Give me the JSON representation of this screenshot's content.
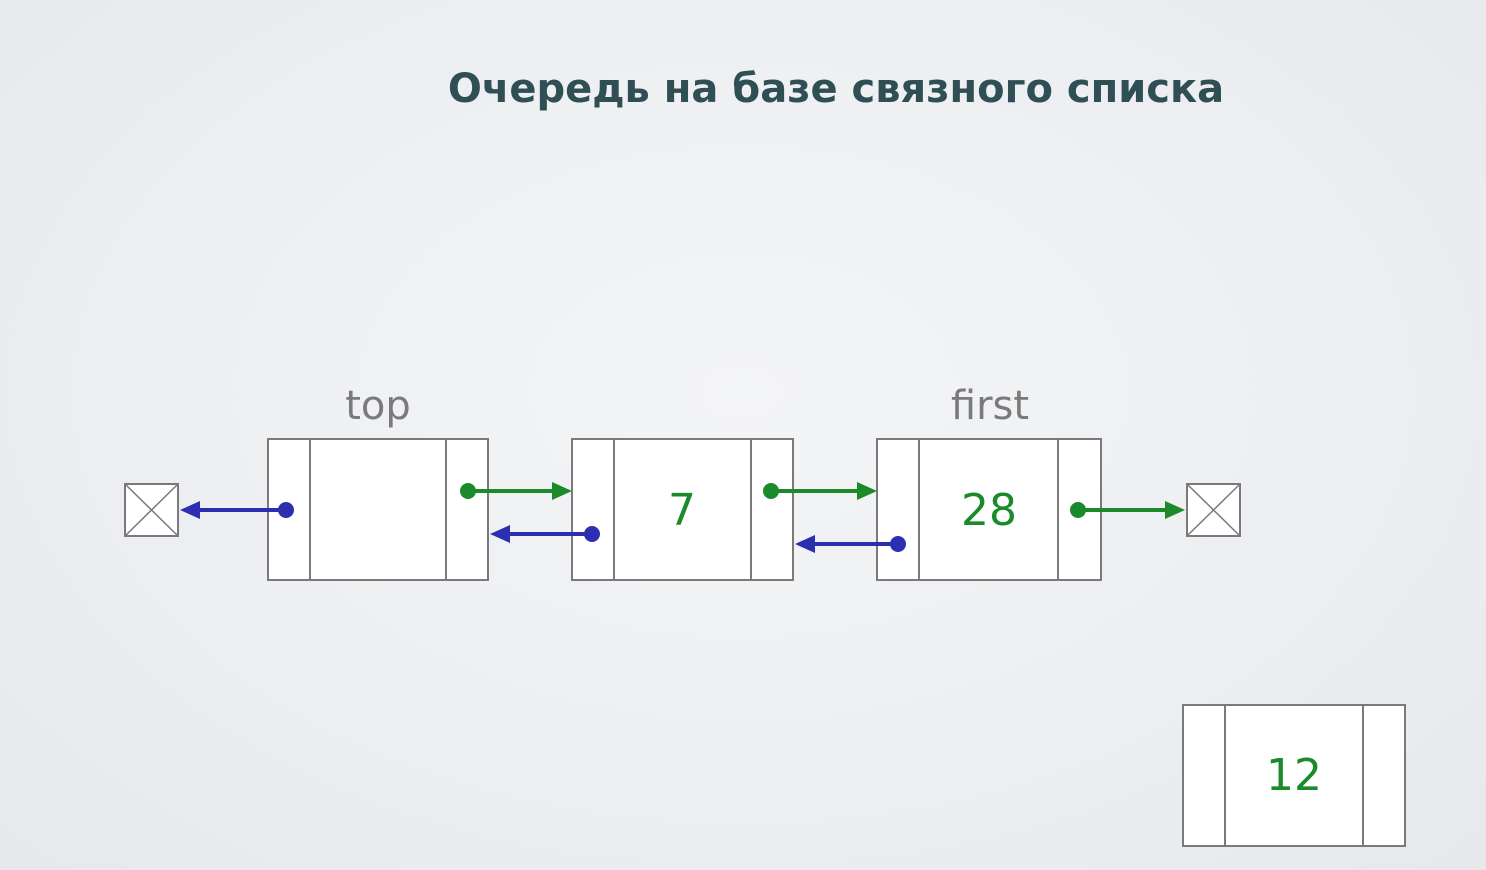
{
  "title": "Очередь на базе связного списка",
  "labels": {
    "top": "top",
    "first": "first"
  },
  "nodes": [
    {
      "id": "node-top",
      "value": ""
    },
    {
      "id": "node-7",
      "value": "7"
    },
    {
      "id": "node-28",
      "value": "28"
    },
    {
      "id": "node-12",
      "value": "12"
    }
  ],
  "colors": {
    "title": "#2f4f55",
    "value_text": "#1a8a2a",
    "next_pointer": "#1a8a2a",
    "prev_pointer": "#2b2fb0",
    "border": "#7a7a7a",
    "label": "#7a7a7a"
  }
}
